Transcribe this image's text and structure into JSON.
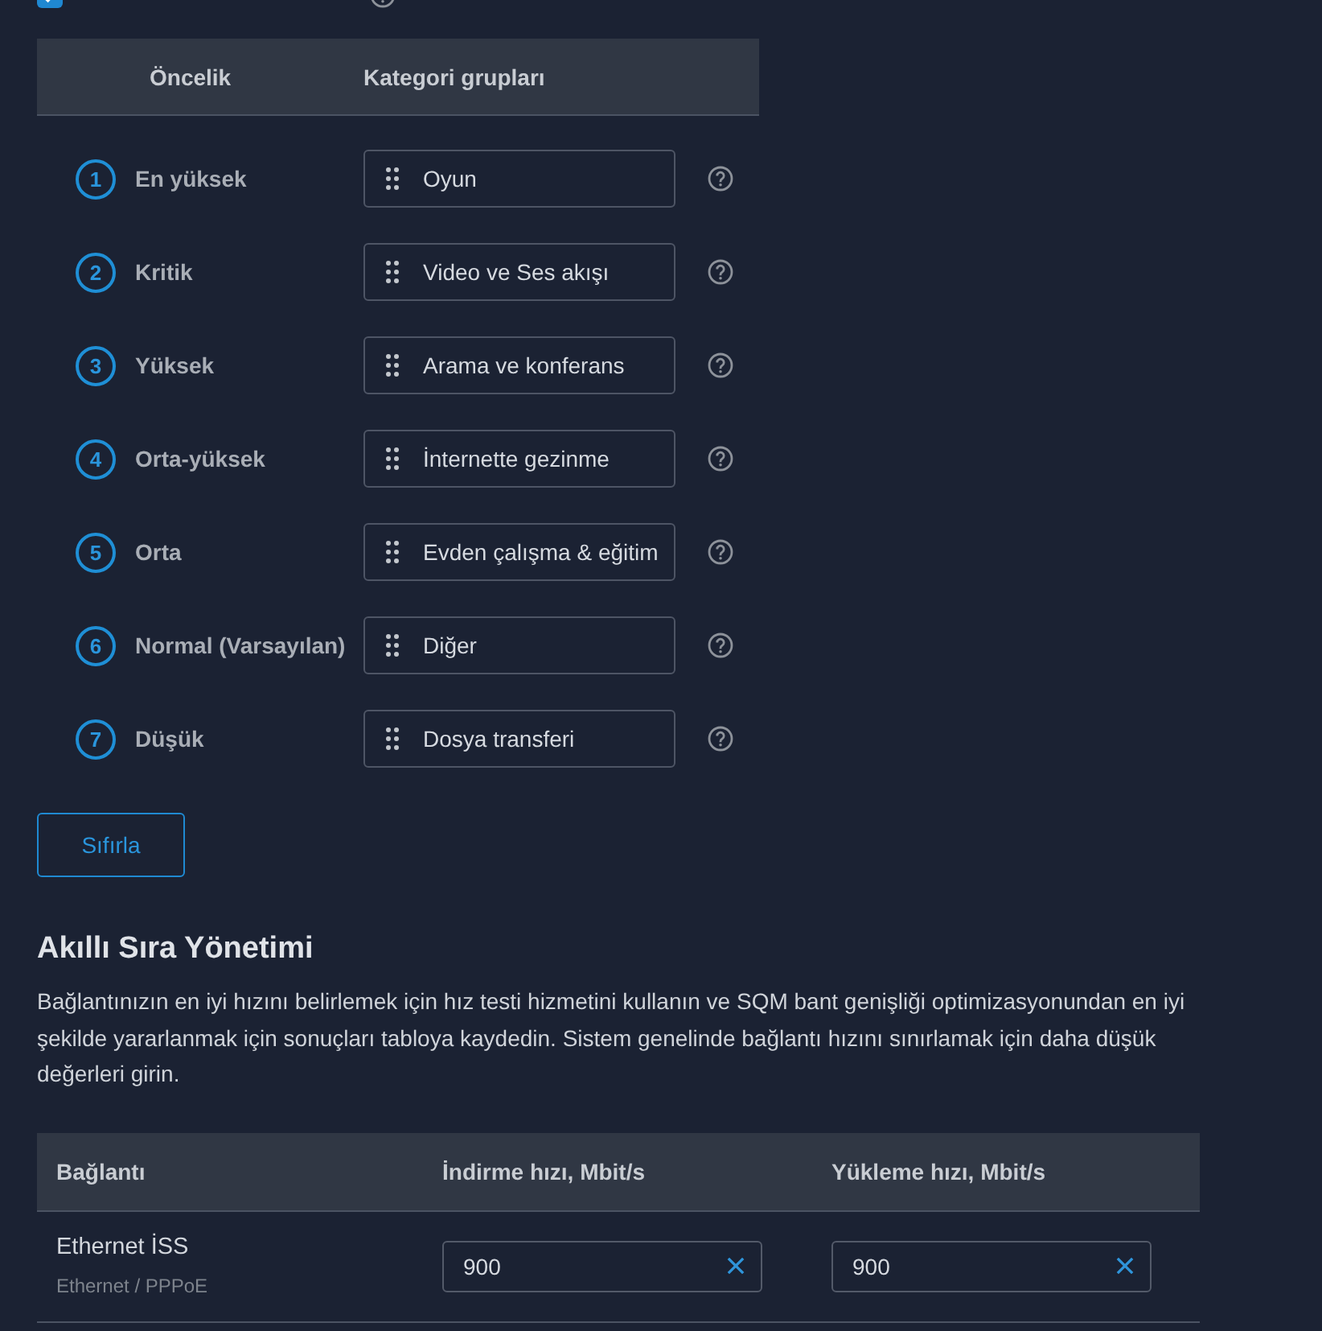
{
  "top_option": {
    "checked": true
  },
  "priority_table": {
    "columns": [
      "Öncelik",
      "Kategori grupları"
    ],
    "rows": [
      {
        "number": "1",
        "priority": "En yüksek",
        "category": "Oyun"
      },
      {
        "number": "2",
        "priority": "Kritik",
        "category": "Video ve Ses akışı"
      },
      {
        "number": "3",
        "priority": "Yüksek",
        "category": "Arama ve konferans"
      },
      {
        "number": "4",
        "priority": "Orta-yüksek",
        "category": "İnternette gezinme"
      },
      {
        "number": "5",
        "priority": "Orta",
        "category": "Evden çalışma & eğitim"
      },
      {
        "number": "6",
        "priority": "Normal (Varsayılan)",
        "category": "Diğer"
      },
      {
        "number": "7",
        "priority": "Düşük",
        "category": "Dosya transferi"
      }
    ]
  },
  "reset_button": "Sıfırla",
  "sqm": {
    "title": "Akıllı Sıra Yönetimi",
    "description": "Bağlantınızın en iyi hızını belirlemek için hız testi hizmetini kullanın ve SQM bant genişliği optimizasyonundan en iyi şekilde yararlanmak için sonuçları tabloya kaydedin. Sistem genelinde bağlantı hızını sınırlamak için daha düşük değerleri girin.",
    "table": {
      "columns": [
        "Bağlantı",
        "İndirme hızı, Mbit/s",
        "Yükleme hızı, Mbit/s"
      ],
      "rows": [
        {
          "connection": "Ethernet İSS",
          "connection_type": "Ethernet / PPPoE",
          "download": "900",
          "upload": "900"
        }
      ]
    }
  }
}
